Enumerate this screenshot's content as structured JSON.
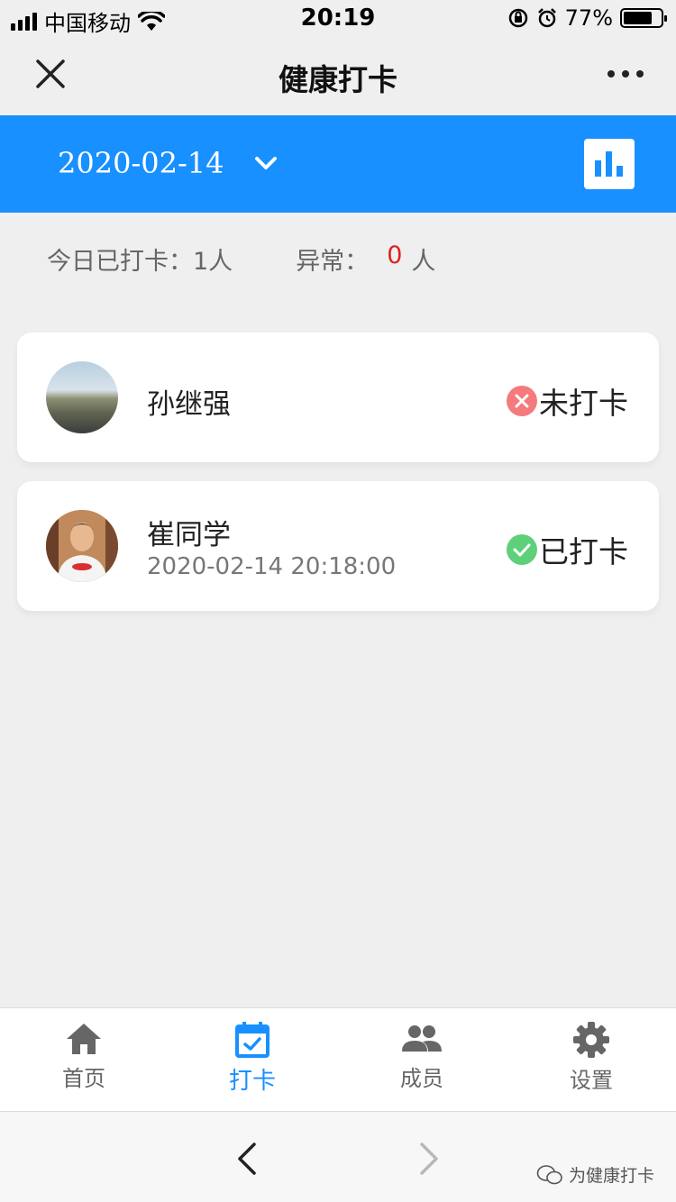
{
  "status_bar": {
    "carrier": "中国移动",
    "time": "20:19",
    "battery": "77%",
    "battery_level": 0.77
  },
  "nav": {
    "title": "健康打卡"
  },
  "date_header": {
    "date": "2020-02-14"
  },
  "summary": {
    "checked_label": "今日已打卡：1人",
    "abnormal_label": "异常：",
    "abnormal_count": "0",
    "abnormal_unit": "人"
  },
  "members": [
    {
      "name": "孙继强",
      "time": "",
      "status": "未打卡",
      "status_color": "#f47a7e"
    },
    {
      "name": "崔同学",
      "time": "2020-02-14 20:18:00",
      "status": "已打卡",
      "status_color": "#5fd07a"
    }
  ],
  "tabs": [
    {
      "label": "首页",
      "icon": "home-icon"
    },
    {
      "label": "打卡",
      "icon": "calendar-check-icon",
      "active": true
    },
    {
      "label": "成员",
      "icon": "people-icon"
    },
    {
      "label": "设置",
      "icon": "gear-icon"
    }
  ],
  "watermark": "为健康打卡",
  "colors": {
    "accent": "#1890ff",
    "abnormal": "#e02020"
  }
}
